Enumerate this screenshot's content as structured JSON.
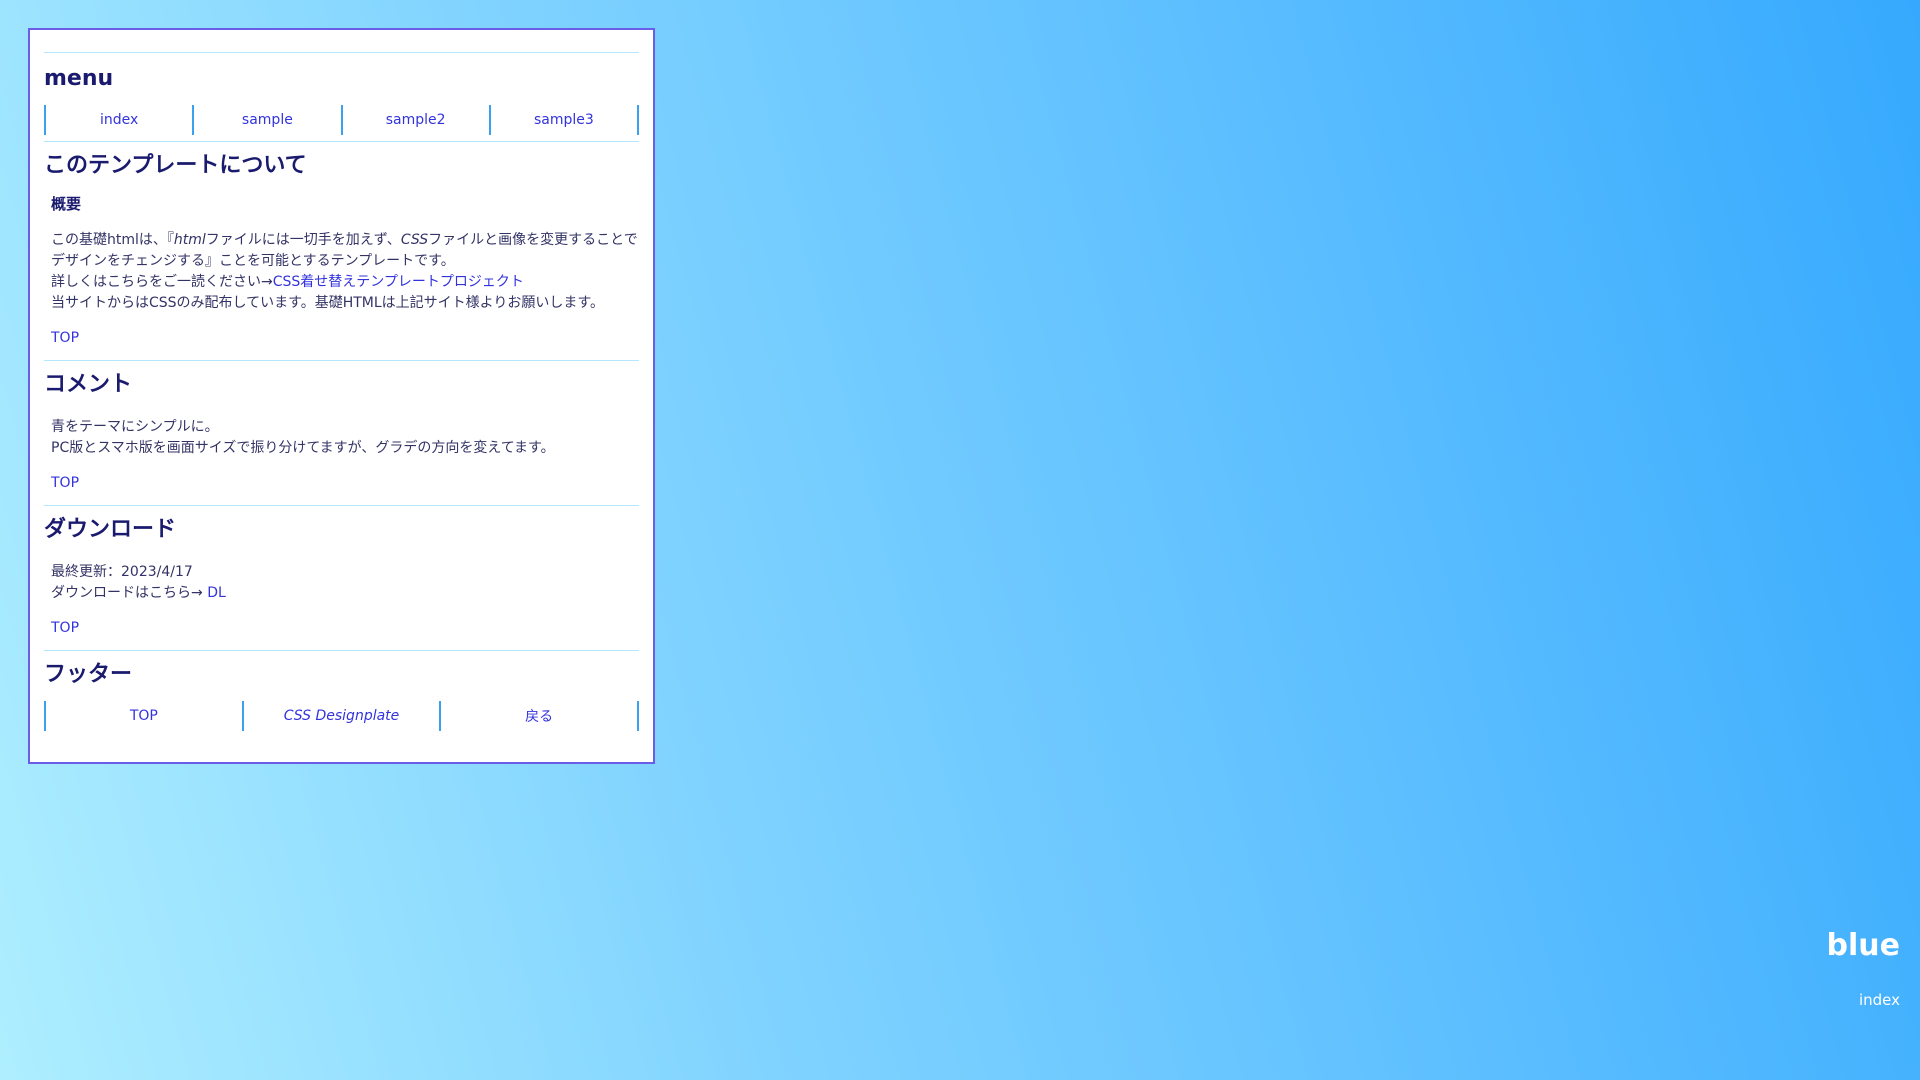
{
  "menu": {
    "title": "menu",
    "items": [
      "index",
      "sample",
      "sample2",
      "sample3"
    ]
  },
  "about": {
    "title": "このテンプレートについて",
    "subtitle": "概要",
    "line1_a": "この基礎htmlは、『",
    "line1_em1": "html",
    "line1_b": "ファイルには一切手を加えず、",
    "line1_em2": "CSS",
    "line1_c": "ファイルと画像を変更することでデザインをチェンジする』ことを可能とするテンプレートです。",
    "line2": "詳しくはこちらをご一読ください→",
    "line2_link": "CSS着せ替えテンプレートプロジェクト",
    "line3": "当サイトからはCSSのみ配布しています。基礎HTMLは上記サイト様よりお願いします。",
    "top_label": "TOP"
  },
  "comment": {
    "title": "コメント",
    "line1": "青をテーマにシンプルに。",
    "line2": "PC版とスマホ版を画面サイズで振り分けてますが、グラデの方向を変えてます。",
    "top_label": "TOP"
  },
  "download": {
    "title": "ダウンロード",
    "line1": "最終更新：2023/4/17",
    "line2": "ダウンロードはこちら→ ",
    "link": "DL",
    "top_label": "TOP"
  },
  "footer": {
    "title": "フッター",
    "items": [
      "TOP",
      "CSS Designplate",
      "戻る"
    ]
  },
  "corner": {
    "title": "blue",
    "link": "index"
  },
  "colors": {
    "panel_border": "#6a5ee8",
    "link": "#3333dd",
    "heading": "#1a1a6e",
    "divider": "#b3e6ff",
    "nav_border": "#3aa0f0"
  }
}
